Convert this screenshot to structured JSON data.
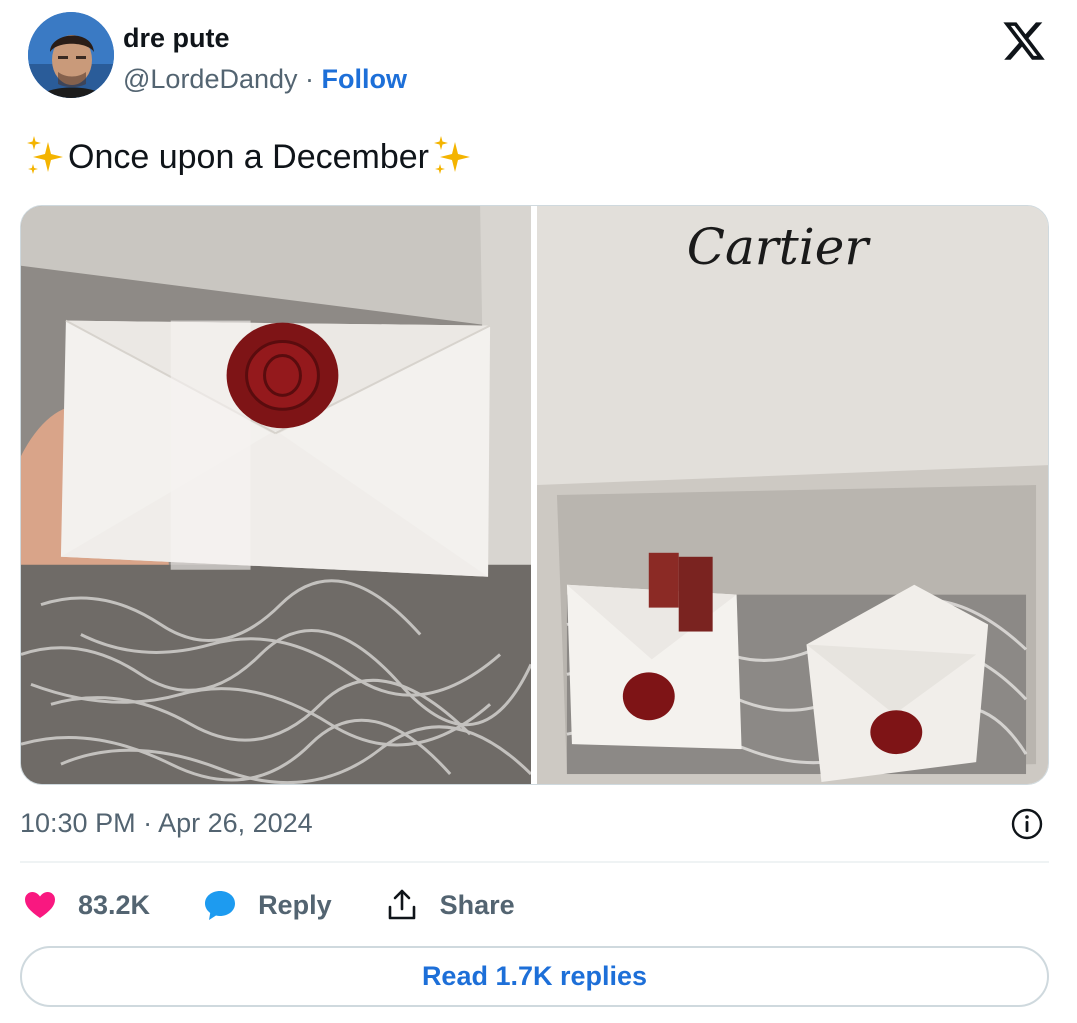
{
  "author": {
    "display_name": "dre pute",
    "handle": "@LordeDandy",
    "separator": "·",
    "follow_label": "Follow"
  },
  "tweet": {
    "text": "Once upon a December",
    "leading_emoji": "sparkles-icon",
    "trailing_emoji": "sparkles-icon"
  },
  "media": {
    "photos": [
      {
        "name": "wax-sealed-package-photo"
      },
      {
        "name": "cartier-box-photo",
        "printed_text": "Cartier"
      }
    ]
  },
  "meta": {
    "timestamp": "10:30 PM · Apr 26, 2024"
  },
  "actions": {
    "like_count": "83.2K",
    "reply_label": "Reply",
    "share_label": "Share"
  },
  "read_replies_label": "Read 1.7K replies",
  "colors": {
    "link_blue": "#1d6fd8",
    "like_pink": "#f91880",
    "reply_blue": "#1d9bf0",
    "muted_gray": "#536471",
    "border_gray": "#cfd9de"
  },
  "icons": {
    "brand": "x-logo-icon",
    "info": "info-icon",
    "like": "heart-icon",
    "reply": "speech-bubble-icon",
    "share": "share-upload-icon"
  }
}
